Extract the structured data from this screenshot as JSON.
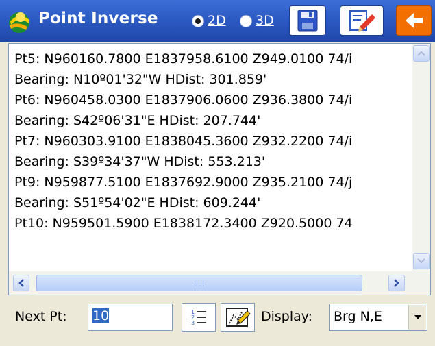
{
  "titlebar": {
    "title": "Point Inverse",
    "mode_2d": "2D",
    "mode_3d": "3D",
    "selected_mode": "2D"
  },
  "output": {
    "lines": [
      "Pt5: N960160.7800 E1837958.6100 Z949.0100 74/i",
      "Bearing: N10º01'32\"W   HDist: 301.859'",
      "Pt6: N960458.0300 E1837906.0600 Z936.3800 74/i",
      "Bearing: S42º06'31\"E    HDist: 207.744'",
      "Pt7: N960303.9100 E1838045.3600 Z932.2200 74/i",
      "Bearing: S39º34'37\"W   HDist: 553.213'",
      "Pt9: N959877.5100 E1837692.9000 Z935.2100 74/j",
      "Bearing: S51º54'02\"E    HDist: 609.244'",
      "Pt10: N959501.5900 E1838172.3400 Z920.5000 74"
    ]
  },
  "bottom": {
    "next_pt_label": "Next Pt:",
    "next_pt_value": "10",
    "display_label": "Display:",
    "display_value": "Brg N,E"
  },
  "colors": {
    "titlebar": "#2d5bc4",
    "back_button": "#f26f00",
    "selection": "#316ac5"
  }
}
